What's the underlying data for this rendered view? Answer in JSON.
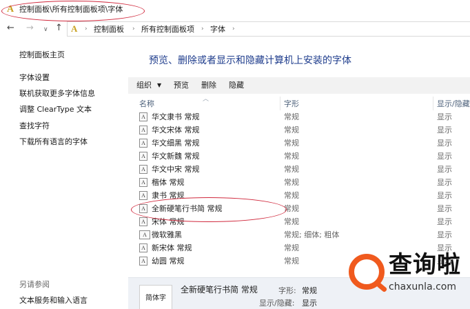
{
  "titlebar": {
    "icon": "A",
    "path": "控制面板\\所有控制面板项\\字体"
  },
  "address": {
    "icon": "A",
    "crumbs": [
      "控制面板",
      "所有控制面板项",
      "字体"
    ],
    "nav_icons": [
      "back-arrow-icon",
      "forward-arrow-icon",
      "recent-dropdown-icon",
      "up-arrow-icon"
    ]
  },
  "sidebar": {
    "home": "控制面板主页",
    "links": [
      "字体设置",
      "联机获取更多字体信息",
      "调整 ClearType 文本",
      "查找字符",
      "下载所有语言的字体"
    ],
    "see_also_heading": "另请参阅",
    "see_also_links": [
      "文本服务和输入语言"
    ]
  },
  "main": {
    "title": "预览、删除或者显示和隐藏计算机上安装的字体"
  },
  "commands": {
    "organize": "组织",
    "preview": "预览",
    "delete": "删除",
    "hide": "隐藏"
  },
  "columns": {
    "name": "名称",
    "style": "字形",
    "show_hide": "显示/隐藏"
  },
  "fonts": [
    {
      "name": "华文隶书 常规",
      "style": "常规",
      "show": "显示"
    },
    {
      "name": "华文宋体 常规",
      "style": "常规",
      "show": "显示"
    },
    {
      "name": "华文细黑 常规",
      "style": "常规",
      "show": "显示"
    },
    {
      "name": "华文新魏 常规",
      "style": "常规",
      "show": "显示"
    },
    {
      "name": "华文中宋 常规",
      "style": "常规",
      "show": "显示"
    },
    {
      "name": "楷体 常规",
      "style": "常规",
      "show": "显示"
    },
    {
      "name": "隶书 常规",
      "style": "常规",
      "show": "显示"
    },
    {
      "name": "全新硬笔行书简 常规",
      "style": "常规",
      "show": "显示"
    },
    {
      "name": "宋体 常规",
      "style": "常规",
      "show": "显示"
    },
    {
      "name": "微软雅黑",
      "style": "常规; 细体; 粗体",
      "show": "显示"
    },
    {
      "name": "新宋体 常规",
      "style": "常规",
      "show": "显示"
    },
    {
      "name": "幼圆 常规",
      "style": "常规",
      "show": "显示"
    }
  ],
  "details": {
    "preview_text": "简体字",
    "name": "全新硬笔行书简 常规",
    "style_label": "字形:",
    "style_value": "常规",
    "show_label": "显示/隐藏:",
    "show_value": "显示"
  },
  "watermark": {
    "title": "查询啦",
    "url": "chaxunla.com"
  }
}
